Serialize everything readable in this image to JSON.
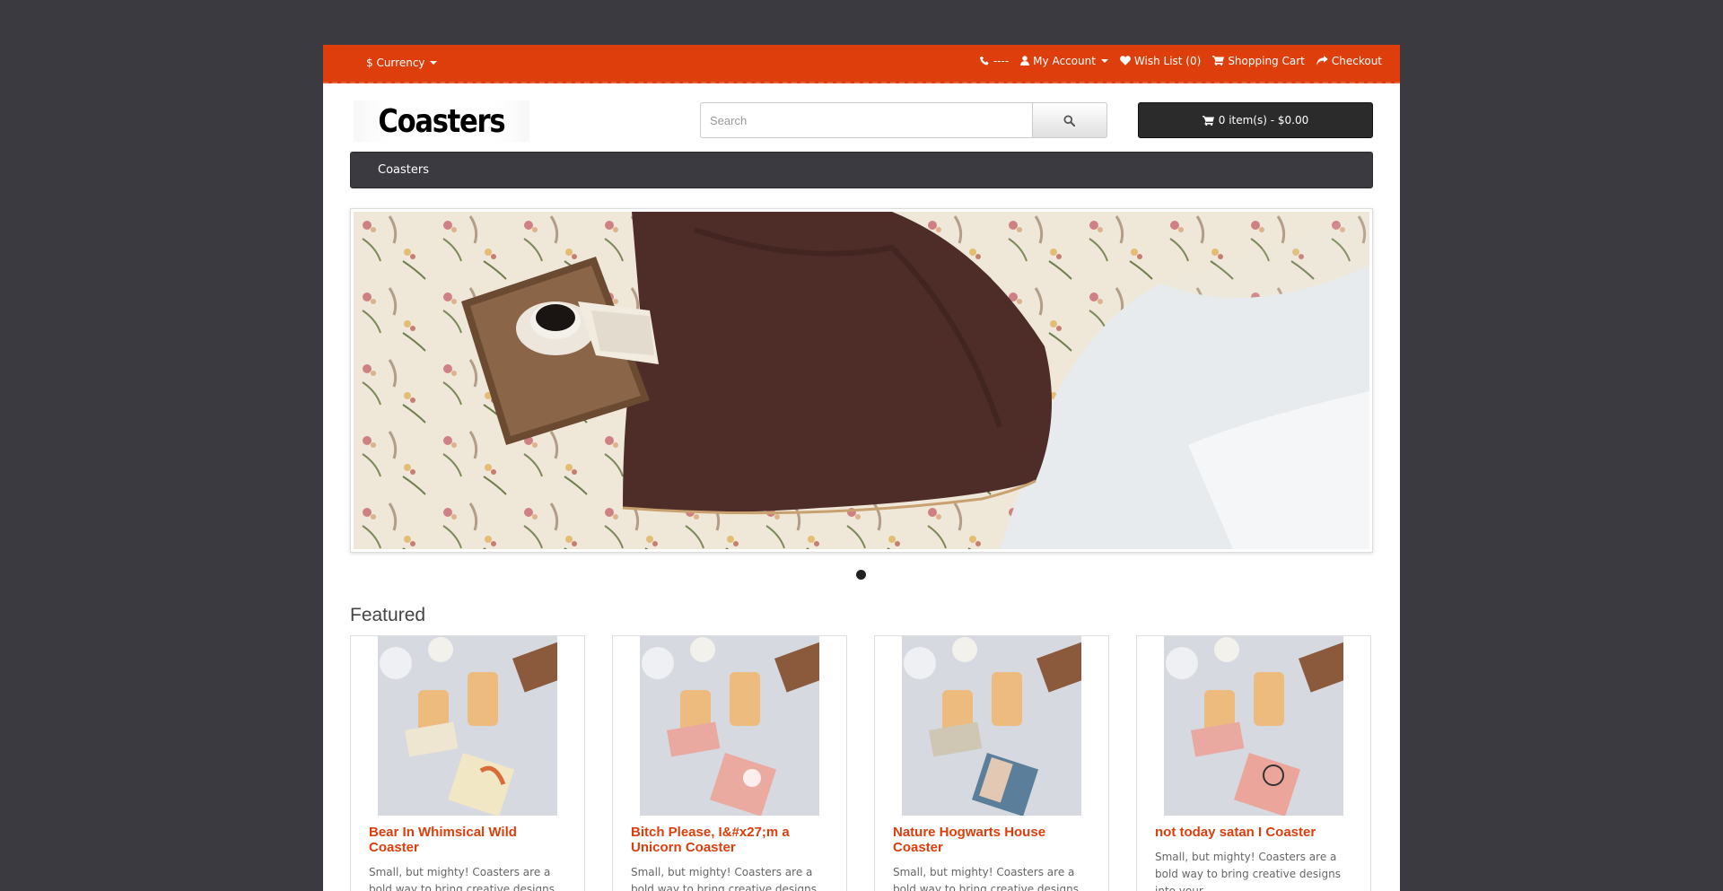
{
  "topbar": {
    "currency_label": "$ Currency",
    "phone_label": "----",
    "my_account_label": "My Account",
    "wishlist_label": "Wish List (0)",
    "shopping_cart_label": "Shopping Cart",
    "checkout_label": "Checkout",
    "bg_color": "#dd3e0b"
  },
  "header": {
    "logo_text": "Coasters",
    "search_placeholder": "Search",
    "search_icon": "search-icon",
    "cart_button_label": "0 item(s) - $0.00"
  },
  "menu": {
    "items": [
      {
        "label": "Coasters"
      }
    ]
  },
  "slideshow": {
    "slide_count": 1,
    "active_slide": 1
  },
  "featured": {
    "title": "Featured",
    "products": [
      {
        "name": "Bear In Whimsical Wild Coaster",
        "description": "Small, but mighty! Coasters are a bold way to bring creative designs into your"
      },
      {
        "name": "Bitch Please, I&#x27;m a Unicorn Coaster",
        "description": "Small, but mighty! Coasters are a bold way to bring creative designs into your"
      },
      {
        "name": "Nature Hogwarts House Coaster",
        "description": "Small, but mighty! Coasters are a bold way to bring creative designs into your"
      },
      {
        "name": "not today satan I Coaster",
        "description": "Small, but mighty! Coasters are a bold way to bring creative designs into your"
      }
    ]
  }
}
